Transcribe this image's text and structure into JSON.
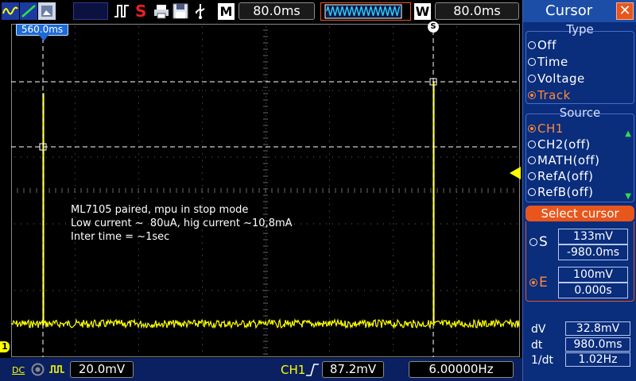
{
  "toolbar": {
    "icons": [
      "waveform-yellow-icon",
      "waveform-green-icon",
      "screenshot-icon",
      "run-stop-icon",
      "single-pulse-icon",
      "s-marker-icon",
      "printer-icon",
      "save-floppy-icon",
      "usb-icon"
    ],
    "m_label": "M",
    "timebase": "80.0ms",
    "w_label": "W",
    "window_timebase": "80.0ms"
  },
  "scope": {
    "time_marker": "560.0ms",
    "s_marker": "S",
    "channel_marker": "1",
    "trace_color": "#ffff00",
    "annotation": {
      "line1": "ML7105 paired, mpu in stop mode",
      "line2": "Low current ~  80uA, hig current ~10,8mA",
      "line3": "Inter time = ~1sec"
    }
  },
  "panel": {
    "title": "Cursor",
    "close_icon": "close-icon",
    "type_group": {
      "title": "Type",
      "options": [
        "Off",
        "Time",
        "Voltage",
        "Track"
      ],
      "selected": "Track"
    },
    "source_group": {
      "title": "Source",
      "options": [
        "CH1",
        "CH2(off)",
        "MATH(off)",
        "RefA(off)",
        "RefB(off)"
      ],
      "selected": "CH1"
    },
    "select_cursor": {
      "title": "Select cursor",
      "s_label": "S",
      "s_voltage": "133mV",
      "s_time": "-980.0ms",
      "e_label": "E",
      "e_voltage": "100mV",
      "e_time": "0.000s",
      "selected": "E"
    },
    "measurements": {
      "dv_label": "dV",
      "dv_value": "32.8mV",
      "dt_label": "dt",
      "dt_value": "980.0ms",
      "inv_dt_label": "1/dt",
      "inv_dt_value": "1.02Hz"
    }
  },
  "status": {
    "coupling": "DC",
    "volts_div": "20.0mV",
    "trigger_source": "CH1",
    "trigger_level": "87.2mV",
    "frequency": "6.00000Hz"
  },
  "colors": {
    "accent": "#e8561c",
    "panel_bg": "#0a2d7c",
    "trace": "#ffff00",
    "bottom_bar": "#0a2060"
  }
}
